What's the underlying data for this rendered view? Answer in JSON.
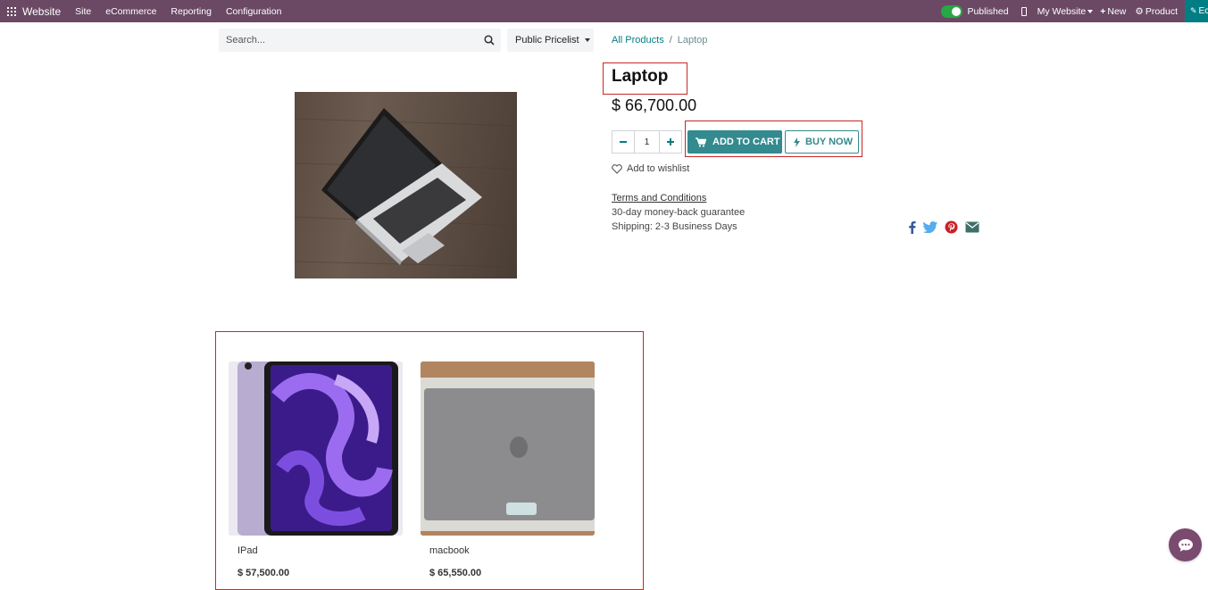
{
  "topbar": {
    "brand": "Website",
    "menu": [
      "Site",
      "eCommerce",
      "Reporting",
      "Configuration"
    ],
    "published_label": "Published",
    "my_website_label": "My Website",
    "new_label": "New",
    "product_label": "Product",
    "edit_label": "Ec",
    "bar_color": "#6b4965"
  },
  "search": {
    "placeholder": "Search..."
  },
  "pricelist": {
    "label": "Public Pricelist"
  },
  "breadcrumb": {
    "parent": "All Products",
    "separator": "/",
    "current": "Laptop"
  },
  "product": {
    "name": "Laptop",
    "price": "$ 66,700.00",
    "quantity": "1",
    "add_to_cart_label": "ADD TO CART",
    "buy_now_label": "BUY NOW",
    "wishlist_label": "Add to wishlist",
    "terms_label": "Terms and Conditions",
    "guarantee": "30-day money-back guarantee",
    "shipping": "Shipping: 2-3 Business Days",
    "accent_color": "#338a8f"
  },
  "share_icons": [
    "facebook-icon",
    "twitter-icon",
    "pinterest-icon",
    "envelope-icon"
  ],
  "alternatives": [
    {
      "name": "IPad",
      "price": "$ 57,500.00"
    },
    {
      "name": "macbook",
      "price": "$ 65,550.00"
    }
  ]
}
